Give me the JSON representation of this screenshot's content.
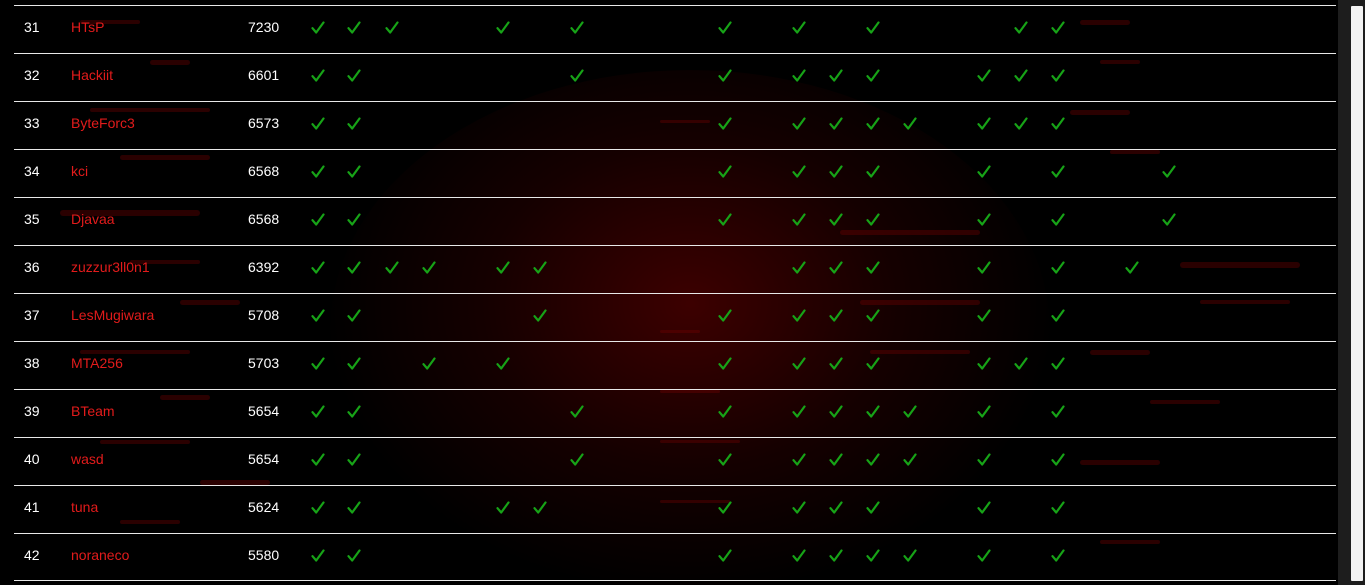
{
  "scoreboard": {
    "check_color": "#17a317",
    "team_color": "#e21b1b",
    "challenge_columns": 22,
    "rows": [
      {
        "rank": "31",
        "team": "HTsP",
        "score": "7230",
        "solved": [
          0,
          1,
          2,
          5,
          7,
          11,
          13,
          15,
          19,
          20
        ]
      },
      {
        "rank": "32",
        "team": "Hackiit",
        "score": "6601",
        "solved": [
          0,
          1,
          7,
          11,
          13,
          14,
          15,
          18,
          19,
          20
        ]
      },
      {
        "rank": "33",
        "team": "ByteForc3",
        "score": "6573",
        "solved": [
          0,
          1,
          11,
          13,
          14,
          15,
          16,
          18,
          19,
          20
        ]
      },
      {
        "rank": "34",
        "team": "kci",
        "score": "6568",
        "solved": [
          0,
          1,
          11,
          13,
          14,
          15,
          18,
          20,
          23
        ]
      },
      {
        "rank": "35",
        "team": "Djavaa",
        "score": "6568",
        "solved": [
          0,
          1,
          11,
          13,
          14,
          15,
          18,
          20,
          23
        ]
      },
      {
        "rank": "36",
        "team": "zuzzur3ll0n1",
        "score": "6392",
        "solved": [
          0,
          1,
          2,
          3,
          5,
          6,
          13,
          14,
          15,
          18,
          20,
          22
        ]
      },
      {
        "rank": "37",
        "team": "LesMugiwara",
        "score": "5708",
        "solved": [
          0,
          1,
          6,
          11,
          13,
          14,
          15,
          18,
          20
        ]
      },
      {
        "rank": "38",
        "team": "MTA256",
        "score": "5703",
        "solved": [
          0,
          1,
          3,
          5,
          11,
          13,
          14,
          15,
          18,
          19,
          20
        ]
      },
      {
        "rank": "39",
        "team": "BTeam",
        "score": "5654",
        "solved": [
          0,
          1,
          7,
          11,
          13,
          14,
          15,
          16,
          18,
          20
        ]
      },
      {
        "rank": "40",
        "team": "wasd",
        "score": "5654",
        "solved": [
          0,
          1,
          7,
          11,
          13,
          14,
          15,
          16,
          18,
          20
        ]
      },
      {
        "rank": "41",
        "team": "tuna",
        "score": "5624",
        "solved": [
          0,
          1,
          5,
          6,
          11,
          13,
          14,
          15,
          18,
          20
        ]
      },
      {
        "rank": "42",
        "team": "noraneco",
        "score": "5580",
        "solved": [
          0,
          1,
          11,
          13,
          14,
          15,
          16,
          18,
          20
        ]
      }
    ]
  }
}
